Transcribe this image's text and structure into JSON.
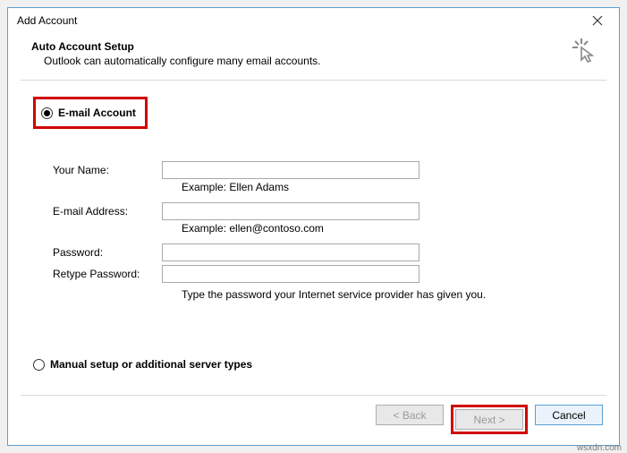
{
  "window": {
    "title": "Add Account"
  },
  "header": {
    "heading": "Auto Account Setup",
    "subtitle": "Outlook can automatically configure many email accounts."
  },
  "options": {
    "email_account_label": "E-mail Account",
    "manual_setup_label": "Manual setup or additional server types"
  },
  "form": {
    "your_name_label": "Your Name:",
    "your_name_value": "",
    "your_name_example": "Example: Ellen Adams",
    "email_label": "E-mail Address:",
    "email_value": "",
    "email_example": "Example: ellen@contoso.com",
    "password_label": "Password:",
    "password_value": "",
    "retype_label": "Retype Password:",
    "retype_value": "",
    "password_hint": "Type the password your Internet service provider has given you."
  },
  "buttons": {
    "back": "< Back",
    "next": "Next >",
    "cancel": "Cancel"
  },
  "attribution": "wsxdn.com"
}
